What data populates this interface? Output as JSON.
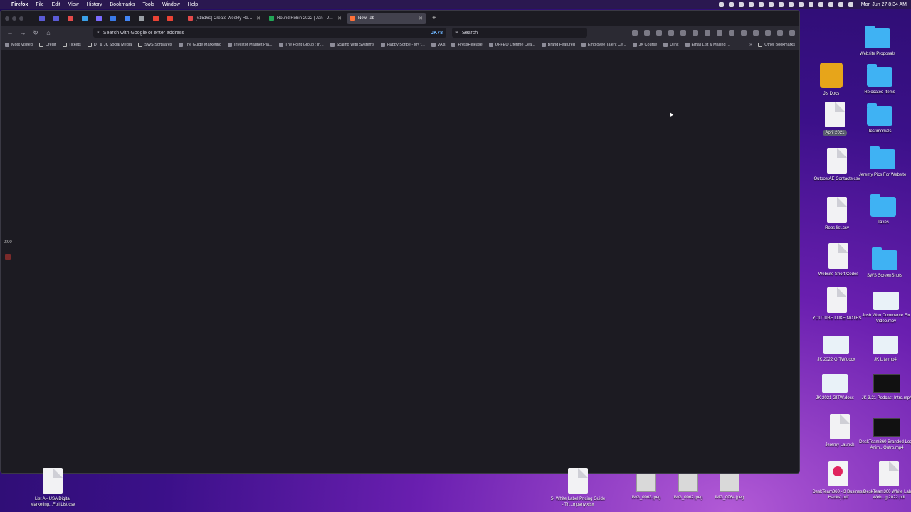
{
  "menubar": {
    "app": "Firefox",
    "menus": [
      "File",
      "Edit",
      "View",
      "History",
      "Bookmarks",
      "Tools",
      "Window",
      "Help"
    ],
    "clock": "Mon Jun 27  8:34 AM"
  },
  "tabs": [
    {
      "title": "[#15160] Create Weekly Recurri",
      "favicon_color": "#e24a4a",
      "active": false
    },
    {
      "title": "Round Robin 2022 | Jan - June",
      "favicon_color": "#22a657",
      "active": false
    },
    {
      "title": "New Tab",
      "favicon_color": "#ff7139",
      "active": true
    }
  ],
  "pinned_colors": [
    "#5b5bd6",
    "#5b5bd6",
    "#e24a4a",
    "#3aa0e8",
    "#7b6bff",
    "#3a7ae8",
    "#4285f4",
    "#9aa0a6",
    "#ea4335",
    "#ea4335"
  ],
  "urlbar": {
    "placeholder": "Search with Google or enter address",
    "extension_badge": "JK78"
  },
  "searchbar": {
    "placeholder": "Search"
  },
  "bookmarks": [
    {
      "label": "Most Visited",
      "folder": false
    },
    {
      "label": "Credit",
      "folder": true
    },
    {
      "label": "Tickets",
      "folder": true
    },
    {
      "label": "DT & JK Social Media",
      "folder": true
    },
    {
      "label": "SWS Softwares",
      "folder": true
    },
    {
      "label": "The Guide Marketing",
      "folder": false
    },
    {
      "label": "Investor Magnet Pla...",
      "folder": false
    },
    {
      "label": "The Point Group : In...",
      "folder": false
    },
    {
      "label": "Scaling With Systems",
      "folder": false
    },
    {
      "label": "Happy Scribe - My t...",
      "folder": false
    },
    {
      "label": "VA's",
      "folder": false
    },
    {
      "label": "PressRelease",
      "folder": false
    },
    {
      "label": "OFFEO Lifetime Dea...",
      "folder": false
    },
    {
      "label": "Brand Featured",
      "folder": false
    },
    {
      "label": "Employee Talent Ce...",
      "folder": false
    },
    {
      "label": "JK Course",
      "folder": false
    },
    {
      "label": "Ulinc",
      "folder": false
    },
    {
      "label": "Email List & Mailing ...",
      "folder": false
    }
  ],
  "other_bookmarks": "Other Bookmarks",
  "overlay": {
    "timer": "0:00"
  },
  "desktop": [
    {
      "label": "Website Proposals",
      "kind": "folder"
    },
    {
      "label": "J's Docs",
      "kind": "drive"
    },
    {
      "label": "Relocated Items",
      "kind": "folder"
    },
    {
      "label": "April 2021",
      "kind": "doc",
      "selected": true
    },
    {
      "label": "Testimonials",
      "kind": "folder"
    },
    {
      "label": "OutpostAE Contacts.csv",
      "kind": "doc"
    },
    {
      "label": "Jeremy Pics For Website",
      "kind": "folder"
    },
    {
      "label": "Robs list.csv",
      "kind": "doc"
    },
    {
      "label": "Taxes",
      "kind": "folder"
    },
    {
      "label": "Website Short Codes",
      "kind": "doc"
    },
    {
      "label": "SWS ScreenShots",
      "kind": "folder"
    },
    {
      "label": "YOUTUBE LUKE NOTES",
      "kind": "doc"
    },
    {
      "label": "Josh Woo Commerce Fix Video.mov",
      "kind": "sheet"
    },
    {
      "label": "JK 2022 GITW.docx",
      "kind": "sheet"
    },
    {
      "label": "JK Lite.mp4",
      "kind": "sheet"
    },
    {
      "label": "JK 2021 GITW.docx",
      "kind": "sheet"
    },
    {
      "label": "JK 3.21 Podcast Intro.mp4",
      "kind": "video"
    },
    {
      "label": "Jeremy Launch",
      "kind": "doc"
    },
    {
      "label": "DeskTeam360 Branded Logo Anim...Outro.mp4",
      "kind": "video"
    },
    {
      "label": "DeskTeam360 - 3 Business Hacks).pdf",
      "kind": "pdf"
    },
    {
      "label": "DeskTeam360 White Label Web...g 2022.pdf",
      "kind": "doc"
    },
    {
      "label": "List A - USA Digital Marketing...Full List.csv",
      "kind": "doc"
    },
    {
      "label": "5- White Label Pricing Guide - Th...mpany.xlsx",
      "kind": "doc"
    },
    {
      "label": "IMG_0063.jpeg",
      "kind": "img"
    },
    {
      "label": "IMG_0062.jpeg",
      "kind": "img"
    },
    {
      "label": "IMG_0064.jpeg",
      "kind": "img"
    }
  ]
}
